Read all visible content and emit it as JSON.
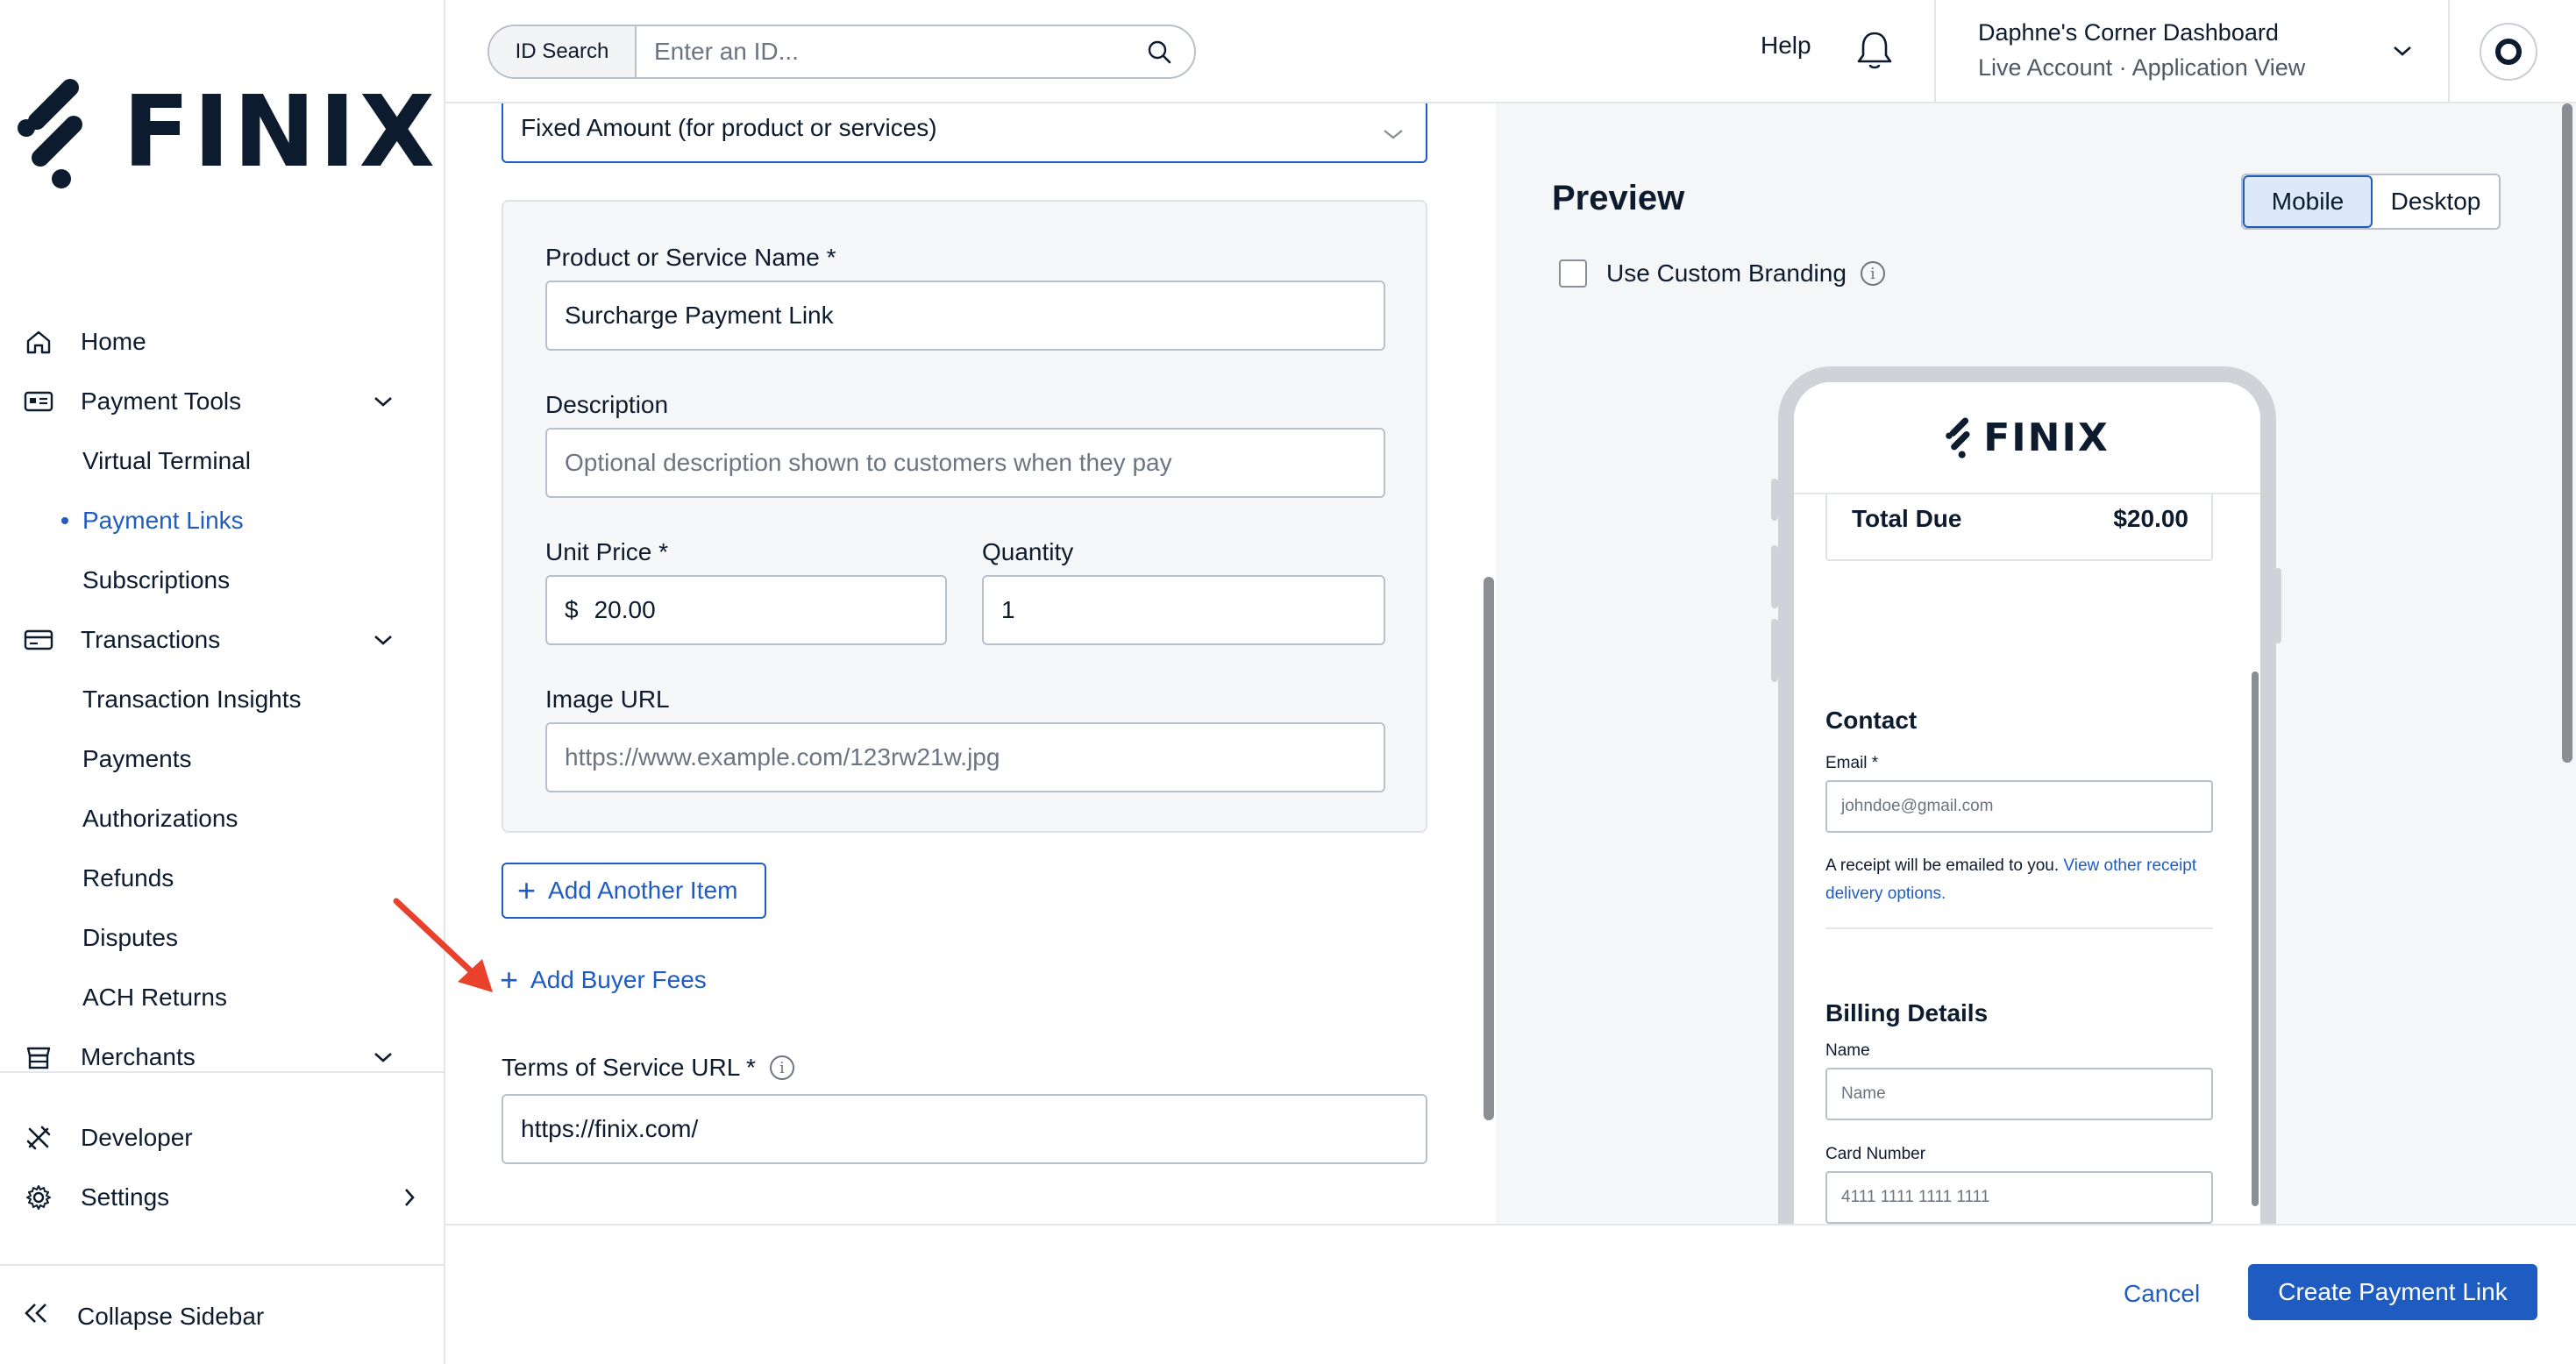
{
  "brand": {
    "logo_text": "FINIX",
    "accent": "#1f5cc2",
    "arrow_color": "#e8412c"
  },
  "sidebar": {
    "items": [
      {
        "label": "Home",
        "icon": "home-icon"
      },
      {
        "label": "Payment Tools",
        "icon": "payment-tools-icon",
        "expanded": true
      },
      {
        "label": "Transactions",
        "icon": "transactions-icon",
        "expanded": true
      },
      {
        "label": "Merchants",
        "icon": "merchants-icon",
        "expanded": true
      },
      {
        "label": "Developer",
        "icon": "developer-icon"
      },
      {
        "label": "Settings",
        "icon": "gear-icon"
      }
    ],
    "payment_tools_sub": [
      "Virtual Terminal",
      "Payment Links",
      "Subscriptions"
    ],
    "active_sub": "Payment Links",
    "transactions_sub": [
      "Transaction Insights",
      "Payments",
      "Authorizations",
      "Refunds",
      "Disputes",
      "ACH Returns"
    ],
    "collapse_label": "Collapse Sidebar"
  },
  "topbar": {
    "id_search_label": "ID Search",
    "id_search_placeholder": "Enter an ID...",
    "help_label": "Help",
    "account_name": "Daphne's Corner Dashboard",
    "account_type": "Live Account",
    "account_view": "Application View"
  },
  "form": {
    "amount_type": "Fixed Amount (for product or services)",
    "product_name_label": "Product or Service Name *",
    "product_name_value": "Surcharge Payment Link",
    "description_label": "Description",
    "description_placeholder": "Optional description shown to customers when they pay",
    "unit_price_label": "Unit Price *",
    "unit_price_currency": "$",
    "unit_price_value": "20.00",
    "quantity_label": "Quantity",
    "quantity_value": "1",
    "image_url_label": "Image URL",
    "image_url_placeholder": "https://www.example.com/123rw21w.jpg",
    "add_item_label": "Add Another Item",
    "add_fees_label": "Add Buyer Fees",
    "tos_label": "Terms of Service URL *",
    "tos_value": "https://finix.com/"
  },
  "preview": {
    "title": "Preview",
    "toggle": [
      "Mobile",
      "Desktop"
    ],
    "toggle_selected": "Mobile",
    "custom_branding_label": "Use Custom Branding",
    "phone": {
      "logo_text": "FINIX",
      "total_label": "Total Due",
      "total_value": "$20.00",
      "contact_heading": "Contact",
      "email_label": "Email *",
      "email_placeholder": "johndoe@gmail.com",
      "receipt_text": "A receipt will be emailed to you.",
      "receipt_link": "View other receipt delivery options.",
      "billing_heading": "Billing Details",
      "name_label": "Name",
      "name_placeholder": "Name",
      "card_label": "Card Number",
      "card_placeholder": "4111 1111 1111 1111"
    }
  },
  "footer": {
    "cancel_label": "Cancel",
    "create_label": "Create Payment Link"
  }
}
